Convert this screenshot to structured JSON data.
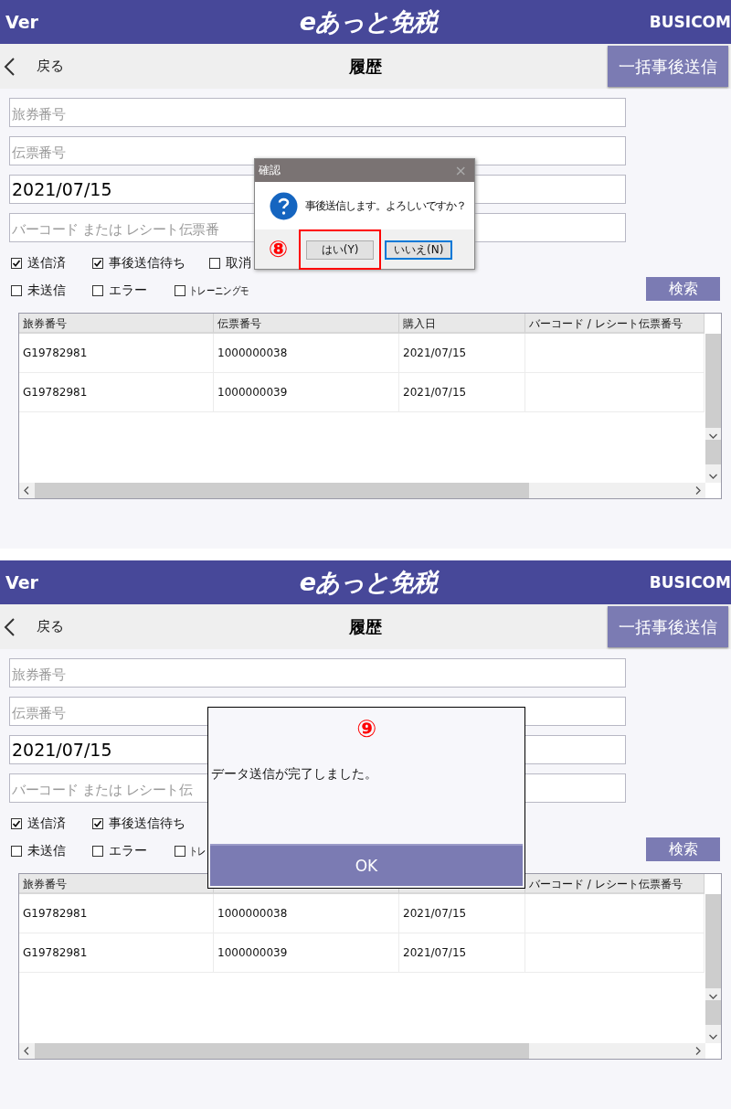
{
  "screens": [
    {
      "header": {
        "left": "Ver",
        "logo": "eあっと免税",
        "right": "BUSICOM"
      },
      "nav": {
        "back": "戻る",
        "title": "履歴",
        "action": "一括事後送信"
      },
      "fields": [
        {
          "placeholder": "旅券番号"
        },
        {
          "placeholder": "伝票番号"
        },
        {
          "value": "2021/07/15"
        },
        {
          "placeholder": "バーコード または レシート伝票番"
        }
      ],
      "filters": [
        [
          {
            "label": "送信済",
            "checked": true
          },
          {
            "label": "事後送信待ち",
            "checked": true
          },
          {
            "label": "取消",
            "checked": false
          }
        ],
        [
          {
            "label": "未送信",
            "checked": false
          },
          {
            "label": "エラー",
            "checked": false
          },
          {
            "label": "トレーニングモ",
            "checked": false,
            "kind": "small"
          }
        ]
      ],
      "search": "検索",
      "table": {
        "columns": [
          {
            "label": "旅券番号"
          },
          {
            "label": "伝票番号"
          },
          {
            "label": "購入日"
          },
          {
            "label": "バーコード / レシート伝票番号"
          }
        ],
        "rows": [
          [
            "G19782981",
            "1000000038",
            "2021/07/15"
          ],
          [
            "G19782981",
            "1000000039",
            "2021/07/15"
          ]
        ]
      },
      "dialog": {
        "kind": "confirm",
        "title": "確認",
        "close": "×",
        "message": "事後送信します。よろしいですか？",
        "annotation": "⑧",
        "buttons": [
          {
            "label": "はい(Y)",
            "highlighted": true,
            "focused": false
          },
          {
            "label": "いいえ(N)",
            "highlighted": false,
            "focused": true
          }
        ]
      }
    },
    {
      "header": {
        "left": "Ver",
        "logo": "eあっと免税",
        "right": "BUSICOM"
      },
      "nav": {
        "back": "戻る",
        "title": "履歴",
        "action": "一括事後送信"
      },
      "fields": [
        {
          "placeholder": "旅券番号"
        },
        {
          "placeholder": "伝票番号"
        },
        {
          "value": "2021/07/15"
        },
        {
          "placeholder": "バーコード または レシート伝"
        }
      ],
      "filters": [
        [
          {
            "label": "送信済",
            "checked": true
          },
          {
            "label": "事後送信待ち",
            "checked": true
          }
        ],
        [
          {
            "label": "未送信",
            "checked": false
          },
          {
            "label": "エラー",
            "checked": false
          },
          {
            "label": "トレ",
            "checked": false,
            "kind": "small"
          }
        ]
      ],
      "search": "検索",
      "table": {
        "columns": [
          {
            "label": "旅券番号"
          },
          {},
          {},
          {
            "label": "バーコード / レシート伝票番号"
          }
        ],
        "rows": [
          [
            "G19782981",
            "1000000038",
            "2021/07/15"
          ],
          [
            "G19782981",
            "1000000039",
            "2021/07/15"
          ]
        ]
      },
      "dialog": {
        "kind": "notice",
        "annotation": "⑨",
        "message": "データ送信が完了しました。",
        "buttons": [
          {
            "label": "OK"
          }
        ]
      }
    }
  ]
}
